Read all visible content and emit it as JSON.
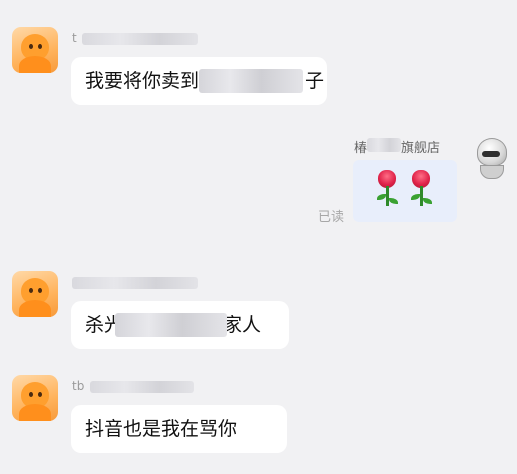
{
  "messages": [
    {
      "side": "left",
      "sender": "t",
      "text_before": "我要将你卖到",
      "text_after": "子"
    },
    {
      "side": "right",
      "sender_prefix": "椿",
      "sender_suffix": "旗舰店",
      "content_type": "image",
      "image_desc": "rose-emoji-pair",
      "status": "已读"
    },
    {
      "side": "left",
      "sender": "",
      "text_before": "杀光",
      "text_after": "家人"
    },
    {
      "side": "left",
      "sender": "tb",
      "text": "抖音也是我在骂你"
    }
  ],
  "colors": {
    "background": "#f1f1f3",
    "bubble": "#ffffff",
    "image_card": "#e8eefb",
    "meta_text": "#9a9a9a"
  }
}
